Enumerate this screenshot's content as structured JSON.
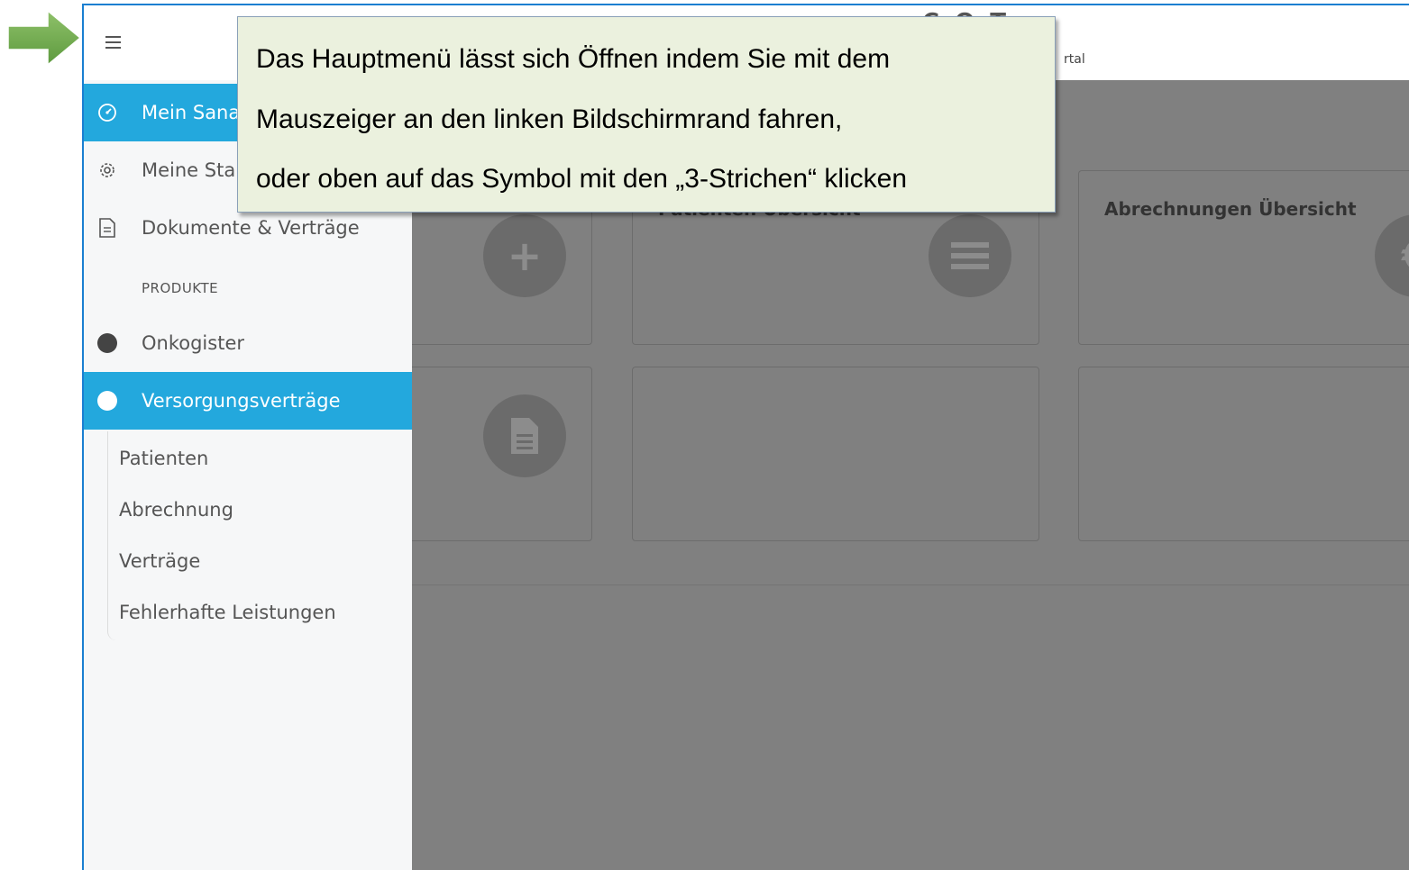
{
  "header": {
    "menu_icon": "hamburger-icon",
    "portal_text": "rtal",
    "logo_fragment": "C O T"
  },
  "sidebar": {
    "items": [
      {
        "label": "Mein Sana",
        "icon": "dashboard-icon",
        "active": true
      },
      {
        "label": "Meine Star",
        "icon": "gear-icon",
        "active": false
      },
      {
        "label": "Dokumente & Verträge",
        "icon": "document-icon",
        "active": false
      }
    ],
    "section_label": "PRODUKTE",
    "products": [
      {
        "label": "Onkogister",
        "icon": "dot-icon",
        "active": false
      },
      {
        "label": "Versorgungsverträge",
        "icon": "dot-icon",
        "active": true
      }
    ],
    "sub_items": [
      "Patienten",
      "Abrechnung",
      "Verträge",
      "Fehlerhafte Leistungen"
    ]
  },
  "cards": [
    {
      "title": "",
      "icon": "plus-icon"
    },
    {
      "title": "Patienten Übersicht",
      "icon": "list-icon"
    },
    {
      "title": "Abrechnungen Übersicht",
      "icon": "euro-icon"
    },
    {
      "title": "",
      "icon": "file-icon"
    },
    {
      "title": "",
      "icon": ""
    },
    {
      "title": "",
      "icon": ""
    }
  ],
  "tooltip": {
    "lines": [
      "Das Hauptmenü lässt sich Öffnen indem Sie mit dem",
      "Mauszeiger an den linken Bildschirmrand fahren,",
      "oder oben auf das Symbol mit den „3-Strichen“ klicken"
    ]
  },
  "colors": {
    "accent": "#23a8dd",
    "overlay": "#808080",
    "tooltip_bg": "#ebf1de",
    "arrow": "#6aa84f",
    "frame_border": "#1a7fd1"
  }
}
